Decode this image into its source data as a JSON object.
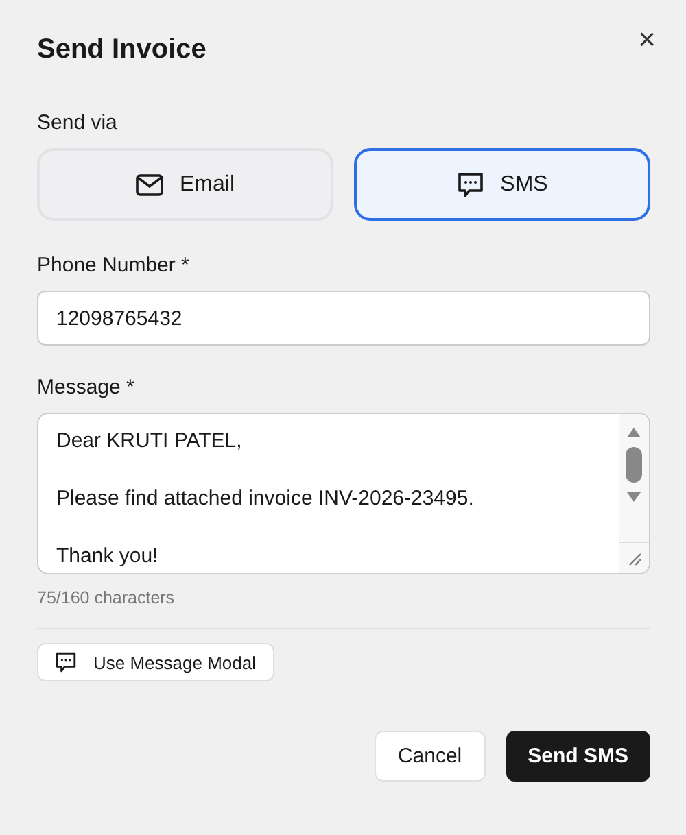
{
  "dialog": {
    "title": "Send Invoice",
    "close_label": "×"
  },
  "send_via": {
    "label": "Send via",
    "options": [
      {
        "kind": "email",
        "label": "Email",
        "selected": false
      },
      {
        "kind": "sms",
        "label": "SMS",
        "selected": true
      }
    ]
  },
  "phone": {
    "label": "Phone Number *",
    "value": "12098765432"
  },
  "message": {
    "label": "Message *",
    "paragraphs": [
      "Dear KRUTI PATEL,",
      "Please find attached invoice INV-2026-23495.",
      "Thank you!"
    ],
    "counter": "75/160 characters"
  },
  "modal_button": {
    "label": "Use Message Modal"
  },
  "footer": {
    "cancel": "Cancel",
    "submit": "Send SMS"
  }
}
